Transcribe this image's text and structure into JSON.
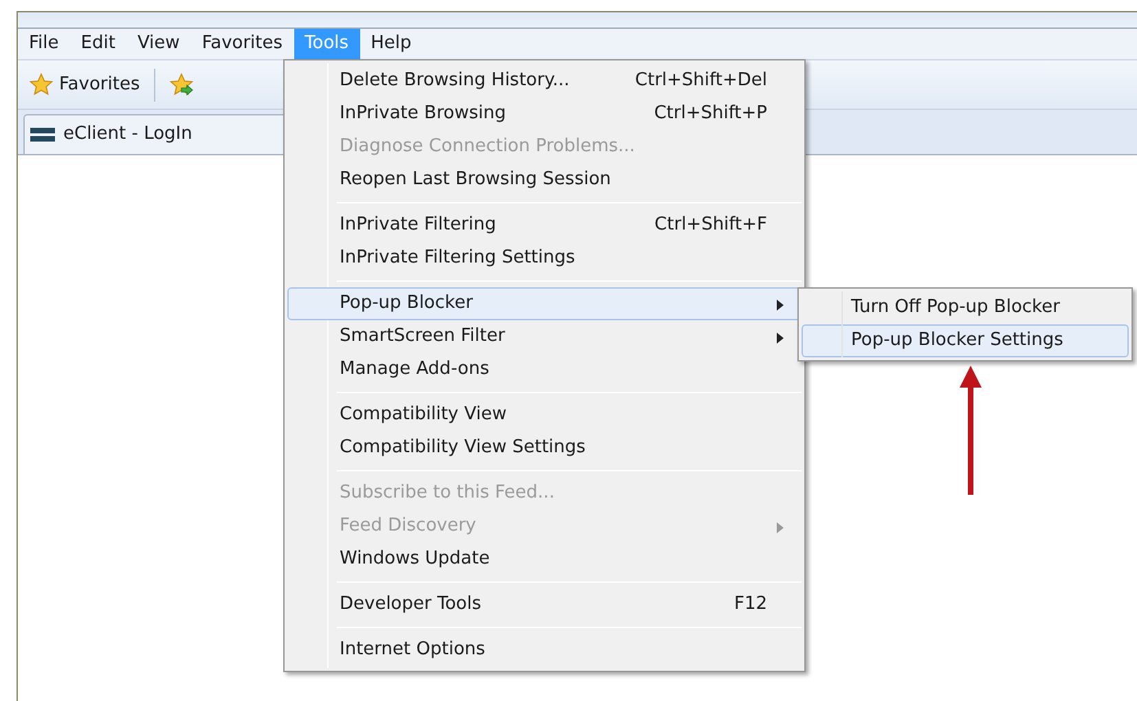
{
  "menu_bar": [
    {
      "label": "File",
      "selected": false
    },
    {
      "label": "Edit",
      "selected": false
    },
    {
      "label": "View",
      "selected": false
    },
    {
      "label": "Favorites",
      "selected": false
    },
    {
      "label": "Tools",
      "selected": true
    },
    {
      "label": "Help",
      "selected": false
    }
  ],
  "favorites_bar": {
    "label": "Favorites"
  },
  "tab": {
    "title": "eClient - LogIn"
  },
  "tools_menu": [
    [
      {
        "label": "Delete Browsing History...",
        "shortcut": "Ctrl+Shift+Del",
        "disabled": false,
        "selected": false,
        "submenu": false
      },
      {
        "label": "InPrivate Browsing",
        "shortcut": "Ctrl+Shift+P",
        "disabled": false,
        "selected": false,
        "submenu": false
      },
      {
        "label": "Diagnose Connection Problems...",
        "disabled": true,
        "selected": false,
        "submenu": false
      },
      {
        "label": "Reopen Last Browsing Session",
        "disabled": false,
        "selected": false,
        "submenu": false
      }
    ],
    [
      {
        "label": "InPrivate Filtering",
        "shortcut": "Ctrl+Shift+F",
        "disabled": false,
        "selected": false,
        "submenu": false
      },
      {
        "label": "InPrivate Filtering Settings",
        "disabled": false,
        "selected": false,
        "submenu": false
      }
    ],
    [
      {
        "label": "Pop-up Blocker",
        "disabled": false,
        "selected": true,
        "submenu": true
      },
      {
        "label": "SmartScreen Filter",
        "disabled": false,
        "selected": false,
        "submenu": true
      },
      {
        "label": "Manage Add-ons",
        "disabled": false,
        "selected": false,
        "submenu": false
      }
    ],
    [
      {
        "label": "Compatibility View",
        "disabled": false,
        "selected": false,
        "submenu": false
      },
      {
        "label": "Compatibility View Settings",
        "disabled": false,
        "selected": false,
        "submenu": false
      }
    ],
    [
      {
        "label": "Subscribe to this Feed...",
        "disabled": true,
        "selected": false,
        "submenu": false
      },
      {
        "label": "Feed Discovery",
        "disabled": true,
        "selected": false,
        "submenu": true
      },
      {
        "label": "Windows Update",
        "disabled": false,
        "selected": false,
        "submenu": false
      }
    ],
    [
      {
        "label": "Developer Tools",
        "shortcut": "F12",
        "disabled": false,
        "selected": false,
        "submenu": false
      }
    ],
    [
      {
        "label": "Internet Options",
        "disabled": false,
        "selected": false,
        "submenu": false
      }
    ]
  ],
  "popup_blocker_submenu": [
    {
      "label": "Turn Off Pop-up Blocker",
      "selected": false
    },
    {
      "label": "Pop-up Blocker Settings",
      "selected": true
    }
  ]
}
